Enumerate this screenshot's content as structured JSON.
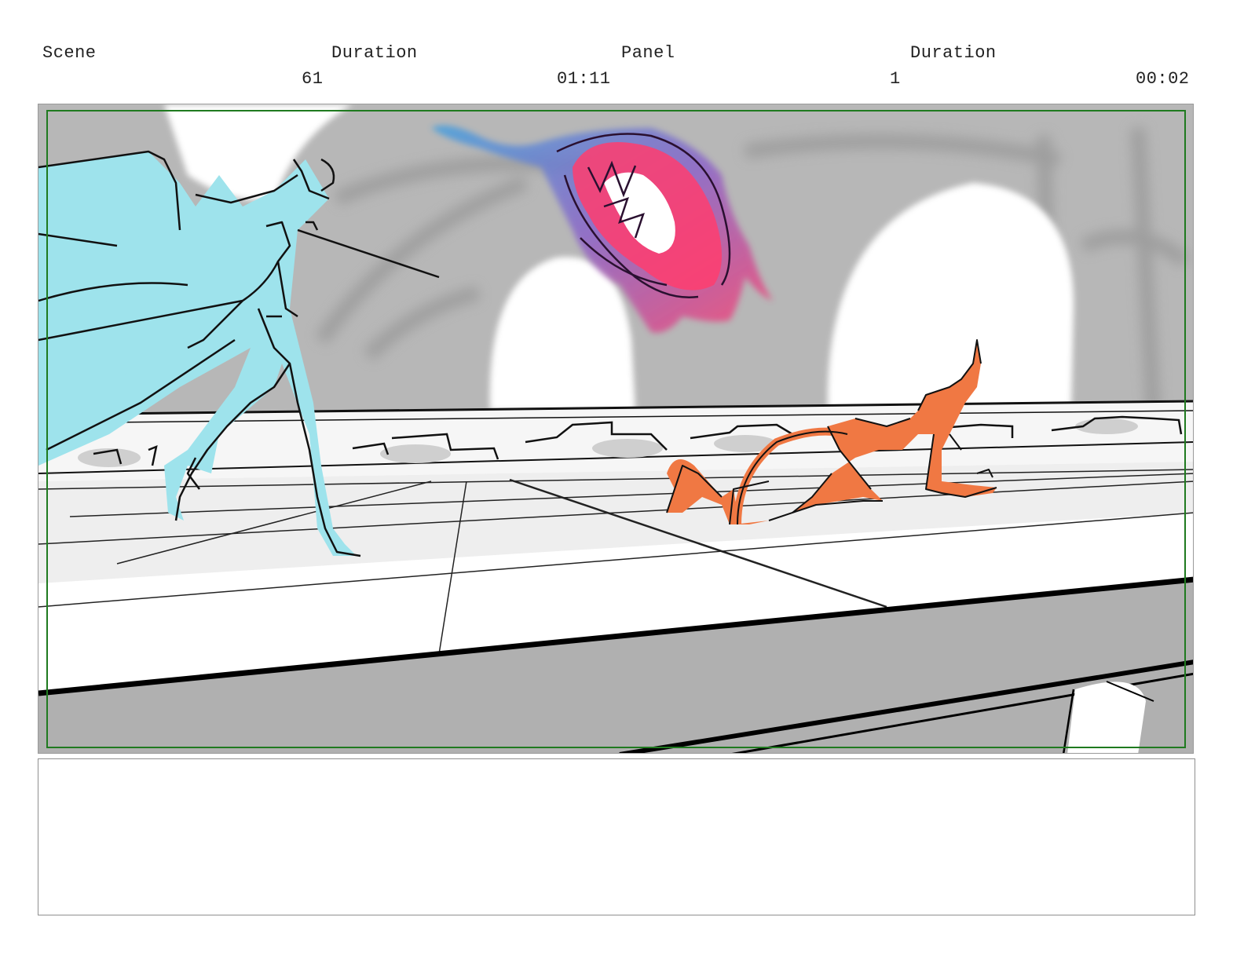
{
  "header": {
    "scene_label": "Scene",
    "scene_duration_label": "Duration",
    "panel_label": "Panel",
    "panel_duration_label": "Duration",
    "scene_number": "61",
    "scene_duration": "01:11",
    "panel_number": "1",
    "panel_duration": "00:02"
  },
  "panel": {
    "safe_frame_color": "#1f7a1f",
    "colors": {
      "left_figure": "#9ee3ec",
      "right_figure": "#f07843",
      "energy_pink": "#ff3d6e",
      "energy_blue": "#3fa0e0",
      "wall_gray": "#b5b5b5",
      "ledge_gray": "#b0b0b0"
    }
  },
  "notes": {
    "text": ""
  }
}
